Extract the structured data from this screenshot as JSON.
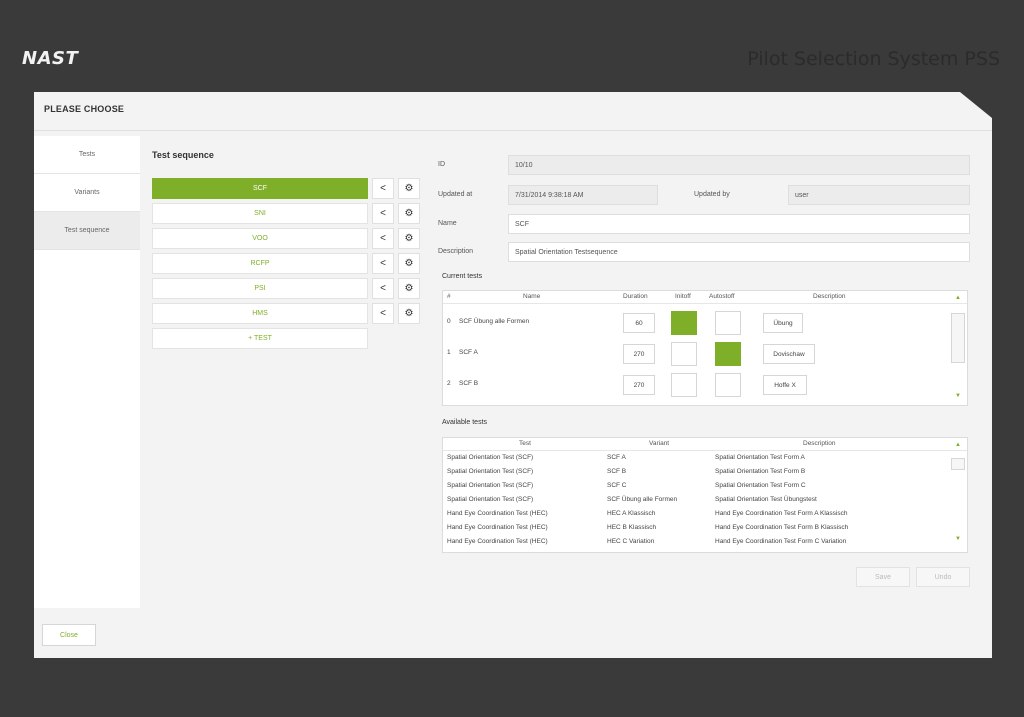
{
  "brand": {
    "logo": "NAST",
    "app_title": "Pilot Selection System PSS"
  },
  "window": {
    "title": "PLEASE CHOOSE"
  },
  "nav": {
    "items": [
      "Tests",
      "Variants",
      "Test sequence"
    ]
  },
  "footer": {
    "close_label": "Close",
    "save_label": "Save",
    "undo_label": "Undo"
  },
  "sequence": {
    "title": "Test sequence",
    "items": [
      "SCF",
      "SNI",
      "VOO",
      "RCFP",
      "PSI",
      "HMS",
      "+ TEST"
    ],
    "selected_index": 0
  },
  "form": {
    "id_label": "ID",
    "id_value": "10/10",
    "updated_at_label": "Updated at",
    "updated_at_value": "7/31/2014 9:38:18 AM",
    "updated_by_label": "Updated by",
    "updated_by_value": "user",
    "name_label": "Name",
    "name_value": "SCF",
    "description_label": "Description",
    "description_value": "Spatial Orientation Testsequence"
  },
  "current_tests": {
    "title": "Current tests",
    "headers": [
      "#",
      "Name",
      "Duration",
      "Initoff",
      "Autostoff",
      "Description"
    ],
    "rows": [
      {
        "index": "0",
        "name": "SCF Übung alle Formen",
        "duration": "60",
        "initoff": true,
        "autostoff": false,
        "description": "Übung"
      },
      {
        "index": "1",
        "name": "SCF A",
        "duration": "270",
        "initoff": false,
        "autostoff": true,
        "description": "Dovischaw"
      },
      {
        "index": "2",
        "name": "SCF B",
        "duration": "270",
        "initoff": false,
        "autostoff": false,
        "description": "Hoffe X"
      }
    ]
  },
  "available_tests": {
    "title": "Available tests",
    "headers": [
      "Test",
      "Variant",
      "Description"
    ],
    "rows": [
      [
        "Spatial Orientation Test (SCF)",
        "SCF A",
        "Spatial Orientation Test Form A"
      ],
      [
        "Spatial Orientation Test (SCF)",
        "SCF B",
        "Spatial Orientation Test Form B"
      ],
      [
        "Spatial Orientation Test (SCF)",
        "SCF C",
        "Spatial Orientation Test Form C"
      ],
      [
        "Spatial Orientation Test (SCF)",
        "SCF Übung alle Formen",
        "Spatial Orientation Test Übungstest"
      ],
      [
        "Hand Eye Coordination Test (HEC)",
        "HEC A Klassisch",
        "Hand Eye Coordination Test Form A Klassisch"
      ],
      [
        "Hand Eye Coordination Test (HEC)",
        "HEC B Klassisch",
        "Hand Eye Coordination Test Form B Klassisch"
      ],
      [
        "Hand Eye Coordination Test (HEC)",
        "HEC C Variation",
        "Hand Eye Coordination Test Form C Variation"
      ]
    ]
  },
  "icons": {
    "share": "share-icon",
    "settings": "gear-icon",
    "scroll_up": "chevron-up-icon",
    "scroll_down": "chevron-down-icon"
  },
  "colors": {
    "accent": "#7fae28",
    "background": "#3a3a3a",
    "window": "#f3f3f3"
  }
}
